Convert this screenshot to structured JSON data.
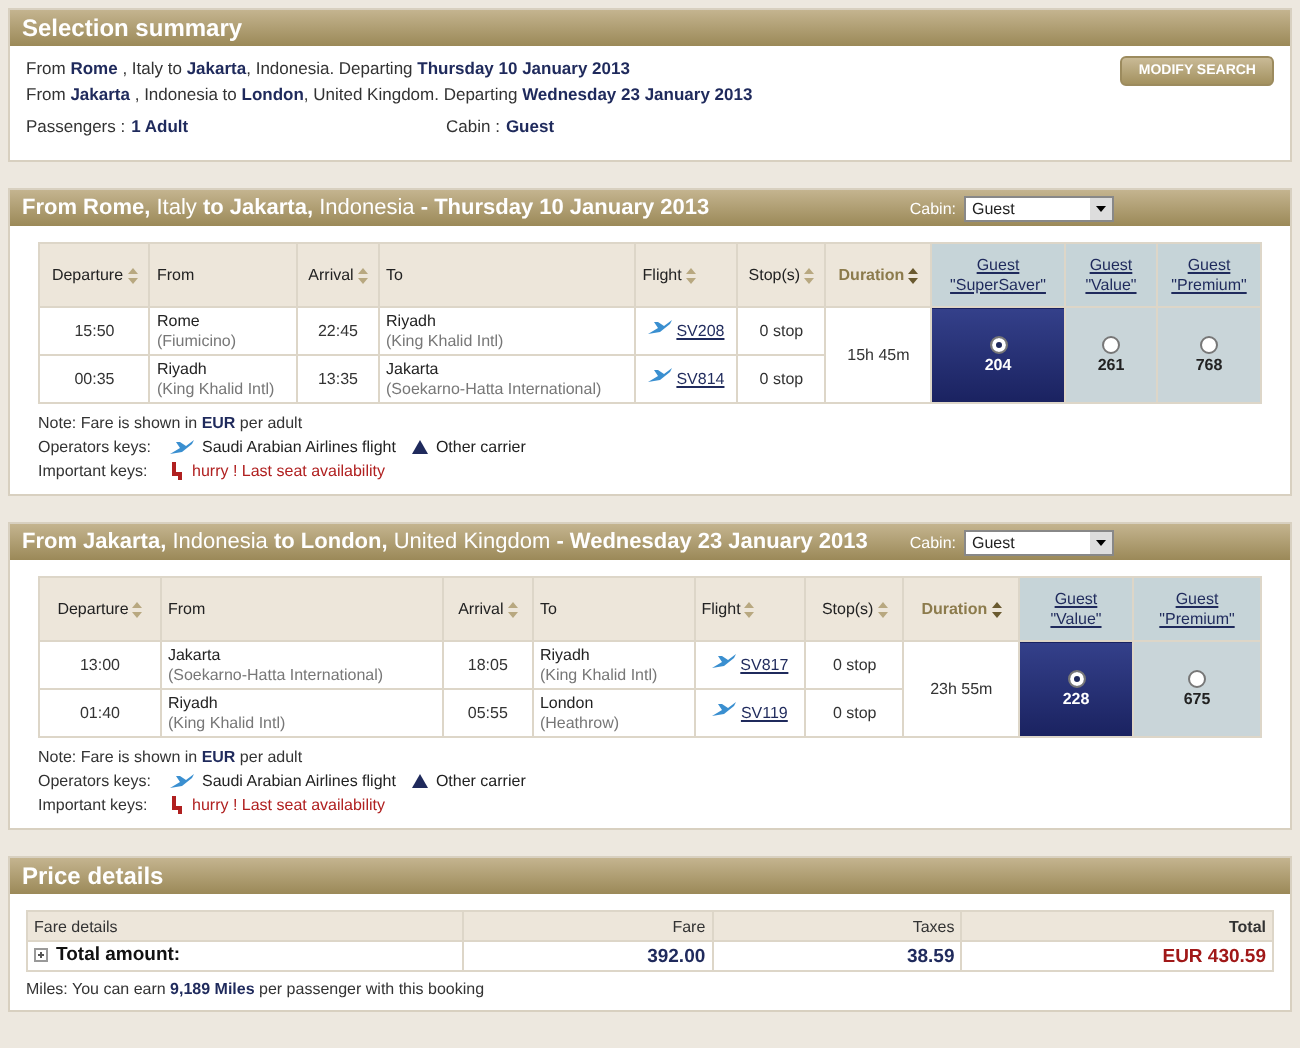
{
  "summary": {
    "title": "Selection summary",
    "routes": [
      "From **Rome** , Italy to **Jakarta**, Indonesia. Departing **Thursday 10 January 2013**",
      "From **Jakarta** , Indonesia to **London**, United Kingdom. Departing **Wednesday 23 January 2013**"
    ],
    "passengers": {
      "label": "Passengers :",
      "value": "1 Adult"
    },
    "cabin": {
      "label": "Cabin :",
      "value": "Guest"
    },
    "modify_button": "MODIFY SEARCH"
  },
  "sections": [
    {
      "title": "**From Rome,** Italy **to Jakarta,** Indonesia **- Thursday 10 January 2013**",
      "cabin_label": "Cabin:",
      "cabin_value": "Guest",
      "columns": [
        {
          "label": "Departure",
          "sortable": true,
          "sorted": false
        },
        {
          "label": "From",
          "sortable": false,
          "sorted": false
        },
        {
          "label": "Arrival",
          "sortable": true,
          "sorted": false
        },
        {
          "label": "To",
          "sortable": false,
          "sorted": false
        },
        {
          "label": "Flight",
          "sortable": true,
          "sorted": false
        },
        {
          "label": "Stop(s)",
          "sortable": true,
          "sorted": false
        },
        {
          "label": "Duration",
          "sortable": true,
          "sorted": true
        }
      ],
      "fares": [
        {
          "name": "Guest",
          "tier": "\"SuperSaver\"",
          "price": "204",
          "selected": true
        },
        {
          "name": "Guest",
          "tier": "\"Value\"",
          "price": "261",
          "selected": false
        },
        {
          "name": "Guest",
          "tier": "\"Premium\"",
          "price": "768",
          "selected": false
        }
      ],
      "legs": [
        {
          "departure": "15:50",
          "from": "Rome",
          "from_detail": "(Fiumicino)",
          "arrival": "22:45",
          "to": "Riyadh",
          "to_detail": "(King Khalid Intl)",
          "flight": "SV208",
          "stops": "0 stop"
        },
        {
          "departure": "00:35",
          "from": "Riyadh",
          "from_detail": "(King Khalid Intl)",
          "arrival": "13:35",
          "to": "Jakarta",
          "to_detail": "(Soekarno-Hatta International)",
          "flight": "SV814",
          "stops": "0 stop"
        }
      ],
      "duration": "15h 45m",
      "note": "Note:  Fare is shown in **EUR** per adult",
      "operators_label": "Operators keys:",
      "operators": [
        {
          "kind": "airline",
          "label": "Saudi Arabian Airlines flight"
        },
        {
          "kind": "other",
          "label": "Other carrier"
        }
      ],
      "important_label": "Important keys:",
      "important": "hurry ! Last seat availability"
    },
    {
      "title": "**From Jakarta,** Indonesia **to London,** United Kingdom **- Wednesday 23 January 2013**",
      "cabin_label": "Cabin:",
      "cabin_value": "Guest",
      "columns": [
        {
          "label": "Departure",
          "sortable": true,
          "sorted": false
        },
        {
          "label": "From",
          "sortable": false,
          "sorted": false
        },
        {
          "label": "Arrival",
          "sortable": true,
          "sorted": false
        },
        {
          "label": "To",
          "sortable": false,
          "sorted": false
        },
        {
          "label": "Flight",
          "sortable": true,
          "sorted": false
        },
        {
          "label": "Stop(s)",
          "sortable": true,
          "sorted": false
        },
        {
          "label": "Duration",
          "sortable": true,
          "sorted": true
        }
      ],
      "fares": [
        {
          "name": "Guest",
          "tier": "\"Value\"",
          "price": "228",
          "selected": true
        },
        {
          "name": "Guest",
          "tier": "\"Premium\"",
          "price": "675",
          "selected": false
        }
      ],
      "legs": [
        {
          "departure": "13:00",
          "from": "Jakarta",
          "from_detail": "(Soekarno-Hatta International)",
          "arrival": "18:05",
          "to": "Riyadh",
          "to_detail": "(King Khalid Intl)",
          "flight": "SV817",
          "stops": "0 stop"
        },
        {
          "departure": "01:40",
          "from": "Riyadh",
          "from_detail": "(King Khalid Intl)",
          "arrival": "05:55",
          "to": "London",
          "to_detail": "(Heathrow)",
          "flight": "SV119",
          "stops": "0 stop"
        }
      ],
      "duration": "23h 55m",
      "note": "Note:  Fare is shown in **EUR** per adult",
      "operators_label": "Operators keys:",
      "operators": [
        {
          "kind": "airline",
          "label": "Saudi Arabian Airlines flight"
        },
        {
          "kind": "other",
          "label": "Other carrier"
        }
      ],
      "important_label": "Important keys:",
      "important": "hurry ! Last seat availability"
    }
  ],
  "price": {
    "title": "Price details",
    "columns": [
      "Fare details",
      "Fare",
      "Taxes",
      "Total"
    ],
    "row": {
      "label": "Total amount:",
      "fare": "392.00",
      "taxes": "38.59",
      "total": "EUR 430.59"
    },
    "miles": "Miles:  You can earn **9,189 Miles** per passenger with this booking"
  }
}
